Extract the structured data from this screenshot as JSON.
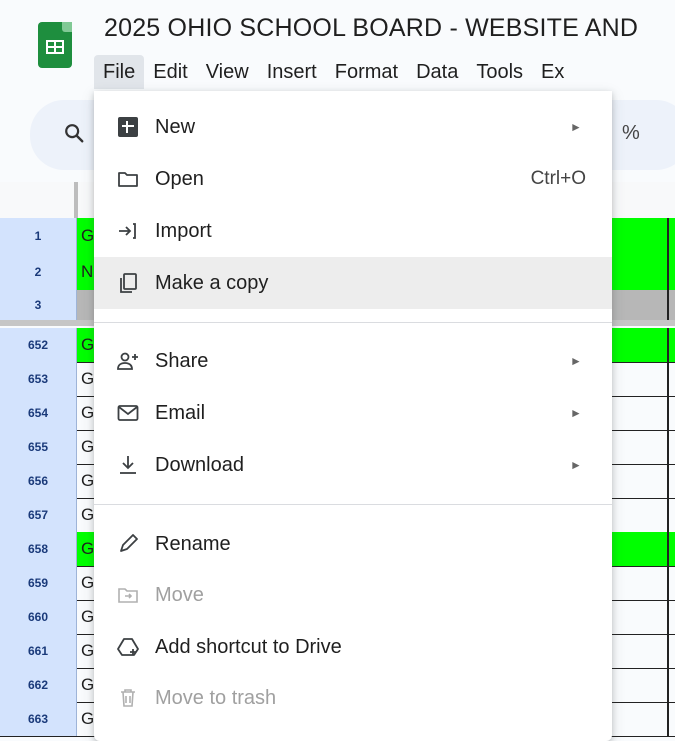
{
  "document": {
    "title": "2025 OHIO SCHOOL BOARD - WEBSITE AND"
  },
  "menubar": [
    "File",
    "Edit",
    "View",
    "Insert",
    "Format",
    "Data",
    "Tools",
    "Ex"
  ],
  "toolbar": {
    "percent": "%",
    "more": "."
  },
  "sheet": {
    "rows": [
      {
        "num": "1",
        "a": "G",
        "fill": "#00ff00"
      },
      {
        "num": "2",
        "a": "N",
        "fill": "#00ff00"
      },
      {
        "num": "3",
        "a": "",
        "fill": "#b7b7b7"
      },
      {
        "num": "652",
        "a": "G",
        "fill": "#00ff00"
      },
      {
        "num": "653",
        "a": "G",
        "fill": ""
      },
      {
        "num": "654",
        "a": "G",
        "fill": ""
      },
      {
        "num": "655",
        "a": "G",
        "fill": ""
      },
      {
        "num": "656",
        "a": "G",
        "fill": ""
      },
      {
        "num": "657",
        "a": "G",
        "fill": ""
      },
      {
        "num": "658",
        "a": "G",
        "fill": "#00ff00"
      },
      {
        "num": "659",
        "a": "G",
        "fill": ""
      },
      {
        "num": "660",
        "a": "G",
        "fill": ""
      },
      {
        "num": "661",
        "a": "G",
        "fill": ""
      },
      {
        "num": "662",
        "a": "G",
        "fill": ""
      },
      {
        "num": "663",
        "a": "G",
        "fill": ""
      }
    ]
  },
  "file_menu": {
    "items": [
      {
        "label": "New",
        "icon": "new-sheet-icon",
        "arrow": "►"
      },
      {
        "label": "Open",
        "icon": "folder-icon",
        "shortcut": "Ctrl+O"
      },
      {
        "label": "Import",
        "icon": "import-icon"
      },
      {
        "label": "Make a copy",
        "icon": "copy-icon"
      },
      {
        "label": "Share",
        "icon": "person-add-icon",
        "arrow": "►"
      },
      {
        "label": "Email",
        "icon": "mail-icon",
        "arrow": "►"
      },
      {
        "label": "Download",
        "icon": "download-icon",
        "arrow": "►"
      },
      {
        "label": "Rename",
        "icon": "pencil-icon"
      },
      {
        "label": "Move",
        "icon": "move-icon",
        "disabled": true
      },
      {
        "label": "Add shortcut to Drive",
        "icon": "drive-shortcut-icon"
      },
      {
        "label": "Move to trash",
        "icon": "trash-icon",
        "disabled": true
      }
    ]
  },
  "colors": {
    "accent_green": "#1e8e3e",
    "cell_green": "#00ff00",
    "row_header": "#d3e3fd",
    "hover": "#ededed"
  }
}
